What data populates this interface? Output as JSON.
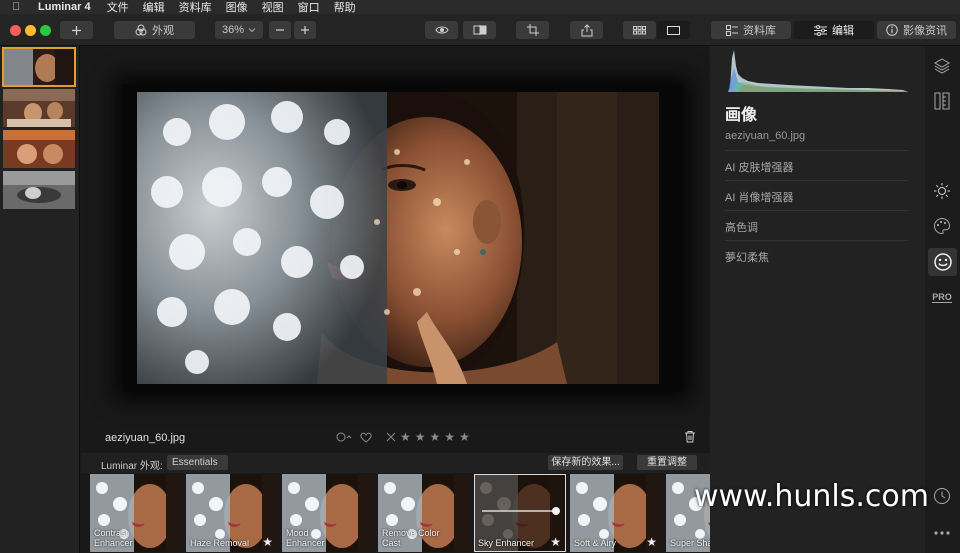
{
  "menubar": {
    "app_name": "Luminar 4",
    "items": [
      "文件",
      "编辑",
      "资料库",
      "图像",
      "视图",
      "窗口",
      "帮助"
    ]
  },
  "toolbar": {
    "looks_label": "外观",
    "zoom": "36%",
    "library_tab": "资料库",
    "edit_tab": "编辑",
    "info_tab": "影像资讯"
  },
  "canvas": {
    "filename": "aeziyuan_60.jpg",
    "rating_stars": 5
  },
  "looks_bar": {
    "label": "Luminar 外观:",
    "selected_collection": "Essentials",
    "save_button": "保存新的效果...",
    "reset_button": "重置调整"
  },
  "presets": [
    {
      "label": "Contrast\nEnhancer",
      "starred": false
    },
    {
      "label": "Haze Removal",
      "starred": true
    },
    {
      "label": "Mood\nEnhancer",
      "starred": false
    },
    {
      "label": "Remove Color\nCast",
      "starred": false
    },
    {
      "label": "Sky Enhancer",
      "starred": true,
      "selected": true
    },
    {
      "label": "Soft & Airy",
      "starred": true
    },
    {
      "label": "Super Sha",
      "starred": false
    }
  ],
  "panel": {
    "title": "画像",
    "filename": "aeziyuan_60.jpg",
    "tools": [
      "AI 皮肤增强器",
      "AI 肖像增强器",
      "高色调",
      "夢幻柔焦"
    ]
  },
  "sidebar": {
    "pro_label": "PRO"
  },
  "watermark": "www.hunls.com",
  "colors": {
    "selection": "#e0a030",
    "bg": "#1a1a1a"
  }
}
